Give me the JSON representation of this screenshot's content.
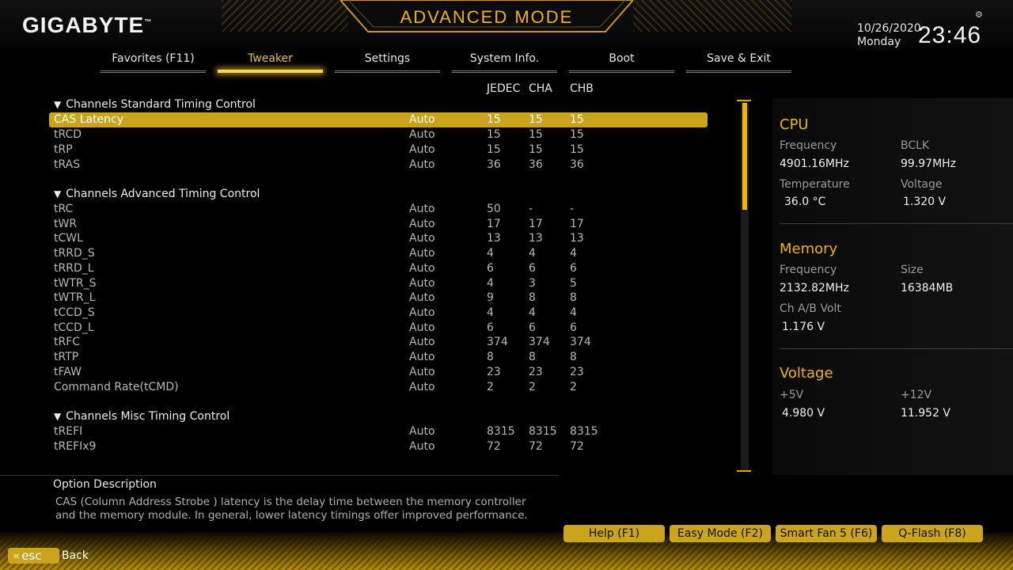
{
  "header": {
    "logo": "GIGABYTE",
    "logo_tm": "™",
    "mode_title": "ADVANCED MODE",
    "date": "10/26/2020",
    "day": "Monday",
    "time": "23:46",
    "settings_icon": "gear-icon"
  },
  "tabs": [
    {
      "label": "Favorites (F11)",
      "active": false
    },
    {
      "label": "Tweaker",
      "active": true
    },
    {
      "label": "Settings",
      "active": false
    },
    {
      "label": "System Info.",
      "active": false
    },
    {
      "label": "Boot",
      "active": false
    },
    {
      "label": "Save & Exit",
      "active": false
    }
  ],
  "columns": {
    "jedec": "JEDEC",
    "cha": "CHA",
    "chb": "CHB"
  },
  "sections": {
    "standard": "Channels Standard Timing Control",
    "advanced": "Channels Advanced Timing Control",
    "misc": "Channels Misc Timing Control",
    "triangle_icon": "triangle-down-icon"
  },
  "rows": {
    "standard": [
      {
        "name": "CAS Latency",
        "value": "Auto",
        "jedec": "15",
        "cha": "15",
        "chb": "15",
        "selected": true
      },
      {
        "name": "tRCD",
        "value": "Auto",
        "jedec": "15",
        "cha": "15",
        "chb": "15"
      },
      {
        "name": "tRP",
        "value": "Auto",
        "jedec": "15",
        "cha": "15",
        "chb": "15"
      },
      {
        "name": "tRAS",
        "value": "Auto",
        "jedec": "36",
        "cha": "36",
        "chb": "36"
      }
    ],
    "advanced": [
      {
        "name": "tRC",
        "value": "Auto",
        "jedec": "50",
        "cha": "-",
        "chb": "-"
      },
      {
        "name": "tWR",
        "value": "Auto",
        "jedec": "17",
        "cha": "17",
        "chb": "17"
      },
      {
        "name": "tCWL",
        "value": "Auto",
        "jedec": "13",
        "cha": "13",
        "chb": "13"
      },
      {
        "name": "tRRD_S",
        "value": "Auto",
        "jedec": "4",
        "cha": "4",
        "chb": "4"
      },
      {
        "name": "tRRD_L",
        "value": "Auto",
        "jedec": "6",
        "cha": "6",
        "chb": "6"
      },
      {
        "name": "tWTR_S",
        "value": "Auto",
        "jedec": "4",
        "cha": "3",
        "chb": "5"
      },
      {
        "name": "tWTR_L",
        "value": "Auto",
        "jedec": "9",
        "cha": "8",
        "chb": "8"
      },
      {
        "name": "tCCD_S",
        "value": "Auto",
        "jedec": "4",
        "cha": "4",
        "chb": "4"
      },
      {
        "name": "tCCD_L",
        "value": "Auto",
        "jedec": "6",
        "cha": "6",
        "chb": "6"
      },
      {
        "name": "tRFC",
        "value": "Auto",
        "jedec": "374",
        "cha": "374",
        "chb": "374"
      },
      {
        "name": "tRTP",
        "value": "Auto",
        "jedec": "8",
        "cha": "8",
        "chb": "8"
      },
      {
        "name": "tFAW",
        "value": "Auto",
        "jedec": "23",
        "cha": "23",
        "chb": "23"
      },
      {
        "name": "Command Rate(tCMD)",
        "value": "Auto",
        "jedec": "2",
        "cha": "2",
        "chb": "2"
      }
    ],
    "misc": [
      {
        "name": "tREFI",
        "value": "Auto",
        "jedec": "8315",
        "cha": "8315",
        "chb": "8315"
      },
      {
        "name": "tREFIx9",
        "value": "Auto",
        "jedec": "72",
        "cha": "72",
        "chb": "72"
      }
    ]
  },
  "info": {
    "cpu": {
      "title": "CPU",
      "frequency_label": "Frequency",
      "frequency": "4901.16MHz",
      "bclk_label": "BCLK",
      "bclk": "99.97MHz",
      "temperature_label": "Temperature",
      "temperature": "36.0 °C",
      "voltage_label": "Voltage",
      "voltage": "1.320 V"
    },
    "memory": {
      "title": "Memory",
      "frequency_label": "Frequency",
      "frequency": "2132.82MHz",
      "size_label": "Size",
      "size": "16384MB",
      "volt_label": "Ch A/B Volt",
      "volt": "1.176 V"
    },
    "voltage": {
      "title": "Voltage",
      "v5_label": "+5V",
      "v5": "4.980 V",
      "v12_label": "+12V",
      "v12": "11.952 V"
    }
  },
  "description": {
    "title": "Option Description",
    "line1": "CAS (Column Address Strobe ) latency is the delay time between the memory controller",
    "line2": "and the memory module. In general, lower latency timings offer improved performance."
  },
  "footer": {
    "help": "Help (F1)",
    "easy_mode": "Easy Mode (F2)",
    "smart_fan": "Smart Fan 5 (F6)",
    "qflash": "Q-Flash (F8)",
    "esc": "esc",
    "back": "Back"
  },
  "scrollbar": {
    "position": 0,
    "visible_fraction": 0.28
  },
  "colors": {
    "accent": "#f0b400",
    "highlight": "#c9a41c"
  }
}
